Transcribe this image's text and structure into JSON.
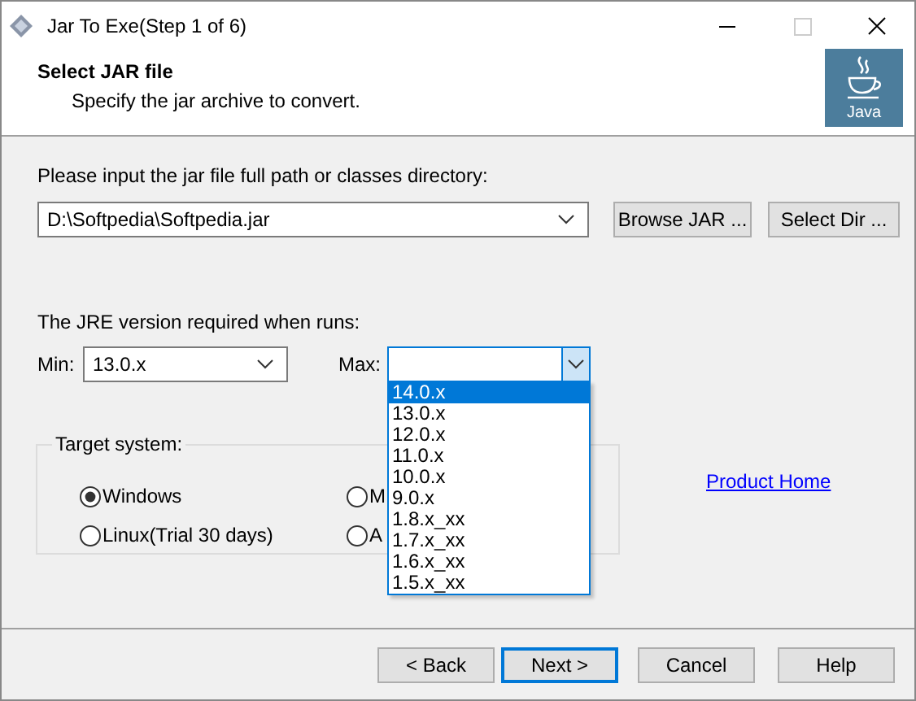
{
  "window": {
    "title": "Jar To Exe(Step 1 of 6)"
  },
  "header": {
    "title": "Select JAR file",
    "subtitle": "Specify the jar archive to convert.",
    "logo_text": "Java"
  },
  "jar_path": {
    "label": "Please input the jar file full path or classes directory:",
    "value": "D:\\Softpedia\\Softpedia.jar"
  },
  "path_buttons": [
    "Browse JAR ...",
    "Select Dir ..."
  ],
  "jre": {
    "label": "The JRE version required when runs:",
    "min": {
      "label": "Min:",
      "value": "13.0.x"
    },
    "max": {
      "label": "Max:",
      "expanded": true,
      "options": [
        {
          "label": "14.0.x",
          "selected": true
        },
        {
          "label": "13.0.x",
          "selected": false
        },
        {
          "label": "12.0.x",
          "selected": false
        },
        {
          "label": "11.0.x",
          "selected": false
        },
        {
          "label": "10.0.x",
          "selected": false
        },
        {
          "label": "9.0.x",
          "selected": false
        },
        {
          "label": "1.8.x_xx",
          "selected": false
        },
        {
          "label": "1.7.x_xx",
          "selected": false
        },
        {
          "label": "1.6.x_xx",
          "selected": false
        },
        {
          "label": "1.5.x_xx",
          "selected": false
        }
      ]
    }
  },
  "target": {
    "label": "Target system:",
    "options": [
      {
        "label": "Windows",
        "selected": true
      },
      {
        "label": "M",
        "selected": false
      },
      {
        "label": "Linux(Trial 30 days)",
        "selected": false
      },
      {
        "label": "A",
        "selected": false
      }
    ]
  },
  "link": "Product Home",
  "buttons": [
    {
      "label": "< Back",
      "focused": false
    },
    {
      "label": "Next >",
      "focused": true
    },
    {
      "label": "Cancel",
      "focused": false
    },
    {
      "label": "Help",
      "focused": false
    }
  ]
}
